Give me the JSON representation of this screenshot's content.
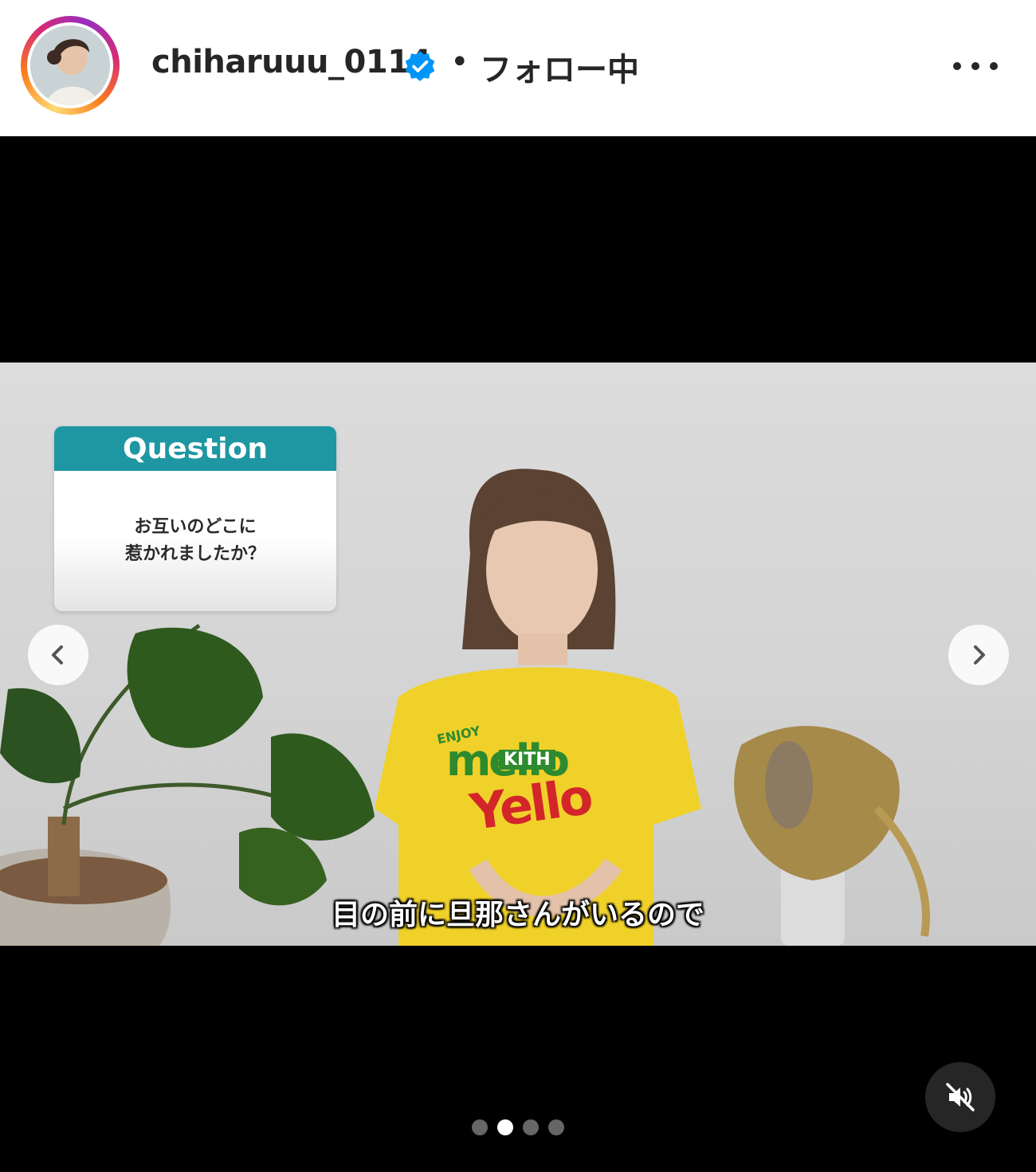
{
  "header": {
    "username": "chiharuuu_0114",
    "separator": "•",
    "follow_status": "フォロー中",
    "verified_color": "#0095f6"
  },
  "post": {
    "question_card": {
      "title": "Question",
      "line1": "お互いのどこに",
      "line2": "惹かれましたか？",
      "accent_color": "#1f97a3"
    },
    "shirt_text": {
      "enjoy": "ENJOY",
      "brand1": "mello",
      "brand2": "Yello",
      "badge": "KITH"
    },
    "subtitle": "目の前に旦那さんがいるので",
    "carousel": {
      "total": 4,
      "active_index": 2
    }
  },
  "icons": {
    "avatar": "profile-avatar",
    "verified": "verified-badge-icon",
    "more": "more-options-icon",
    "prev": "chevron-left-icon",
    "next": "chevron-right-icon",
    "mute": "speaker-muted-icon"
  }
}
